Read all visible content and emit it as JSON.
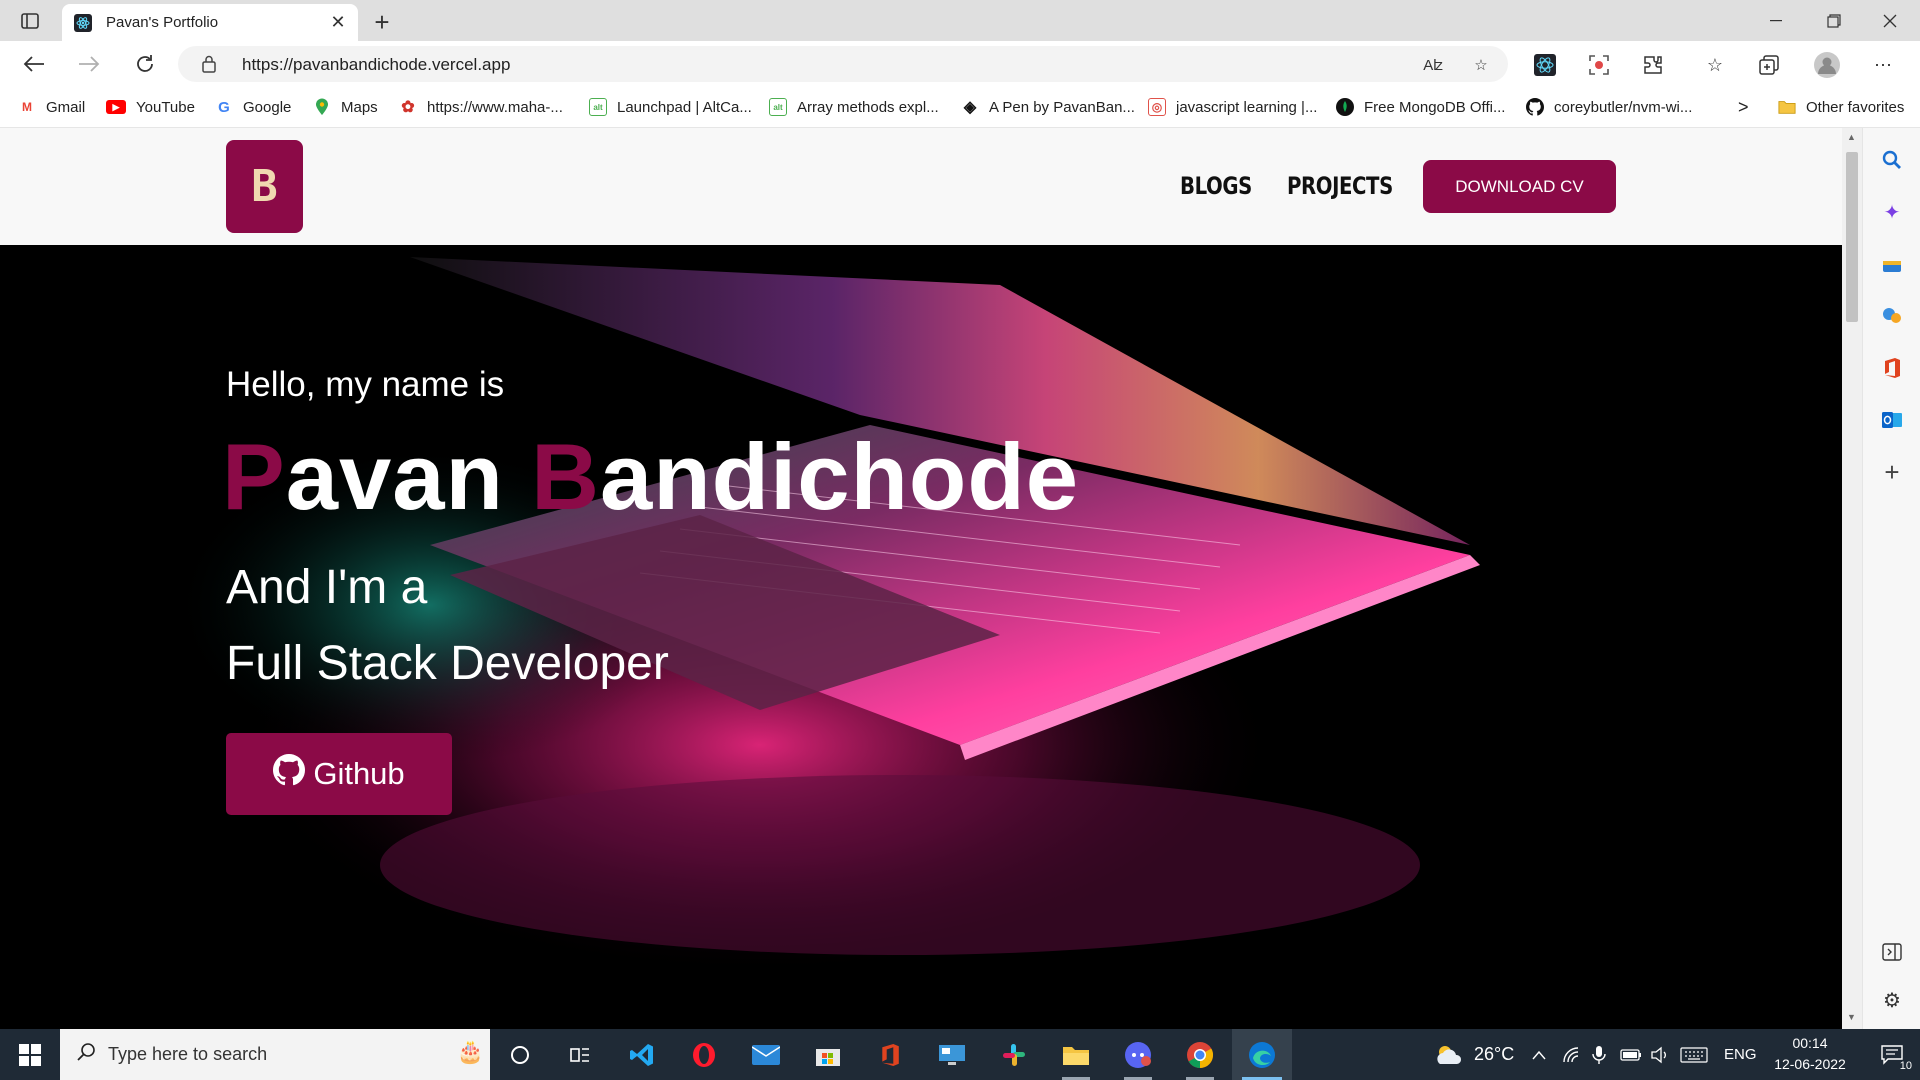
{
  "browser": {
    "tab_title": "Pavan's Portfolio",
    "close_tab": "✕",
    "new_tab": "+",
    "url": "https://pavanbandichode.vercel.app",
    "read_aloud": "Aʫ",
    "bookmarks": [
      {
        "label": "Gmail",
        "icon": "gmail-icon",
        "glyph": "M",
        "color": "#ea4335"
      },
      {
        "label": "YouTube",
        "icon": "youtube-icon",
        "glyph": "▶",
        "color": "#ff0000"
      },
      {
        "label": "Google",
        "icon": "google-icon",
        "glyph": "G",
        "color": "#4285f4"
      },
      {
        "label": "Maps",
        "icon": "maps-icon",
        "glyph": "⬤",
        "color": "#34a853"
      },
      {
        "label": "https://www.maha-...",
        "icon": "maha-icon",
        "glyph": "✿",
        "color": "#d0342c"
      },
      {
        "label": "Launchpad | AltCa...",
        "icon": "altcampus-icon",
        "glyph": "alt",
        "color": "#4caf50"
      },
      {
        "label": "Array methods expl...",
        "icon": "altcampus-icon",
        "glyph": "alt",
        "color": "#4caf50"
      },
      {
        "label": "A Pen by PavanBan...",
        "icon": "codepen-icon",
        "glyph": "◈",
        "color": "#111111"
      },
      {
        "label": "javascript learning |...",
        "icon": "learning-icon",
        "glyph": "◎",
        "color": "#e0524a"
      },
      {
        "label": "Free MongoDB Offi...",
        "icon": "mongodb-icon",
        "glyph": "●",
        "color": "#13aa52"
      },
      {
        "label": "coreybutler/nvm-wi...",
        "icon": "github-icon",
        "glyph": "●",
        "color": "#111111"
      }
    ],
    "more_bookmarks": ">",
    "other_favorites": "Other favorites"
  },
  "site": {
    "logo_letter": "B",
    "nav": {
      "blogs": "BLOGS",
      "projects": "PROJECTS",
      "download_cv": "DOWNLOAD CV"
    },
    "hero": {
      "greeting": "Hello, my name is",
      "first_initial": "P",
      "first_rest": "avan ",
      "last_initial": "B",
      "last_rest": "andichode",
      "and_im": "And I'm a",
      "role": "Full Stack Developer",
      "github_button": "Github"
    }
  },
  "taskbar": {
    "search_placeholder": "Type here to search",
    "weather": "26°C",
    "language": "ENG",
    "time": "00:14",
    "date": "12-06-2022",
    "notifications_count": "10"
  },
  "colors": {
    "brand": "#8b0a47",
    "taskbar": "#1f2a36"
  }
}
